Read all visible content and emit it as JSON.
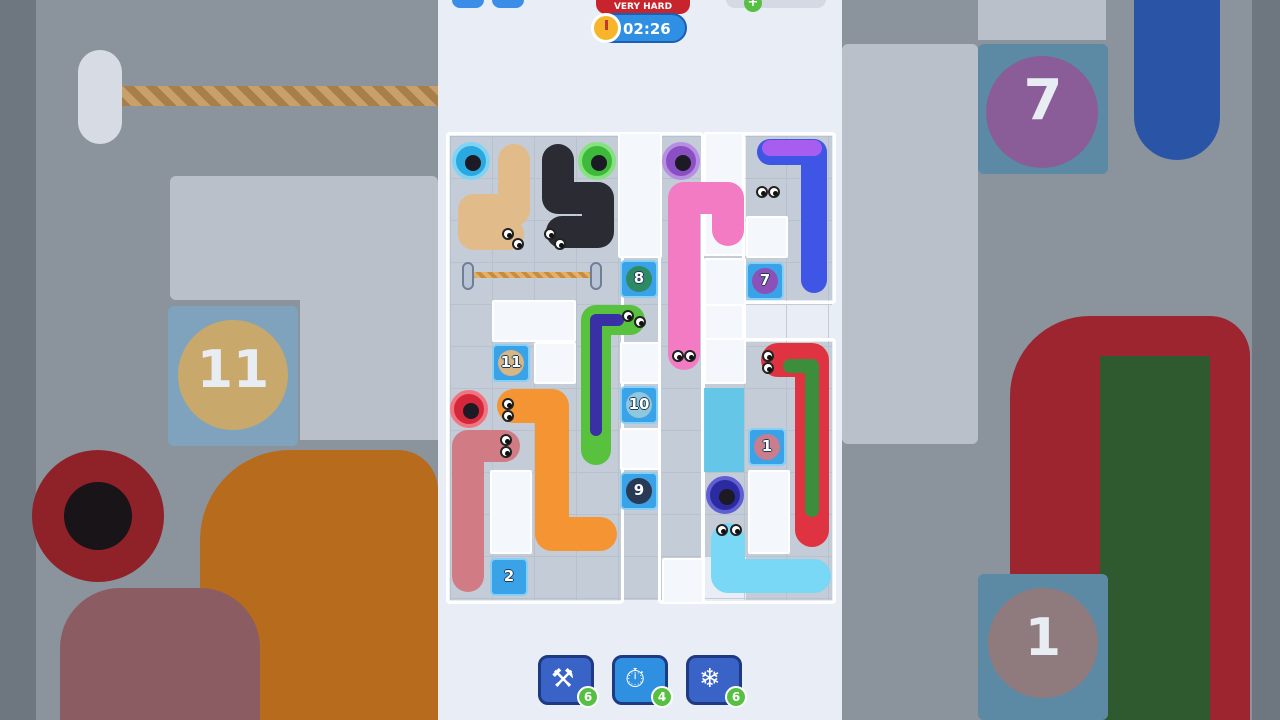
{
  "hud": {
    "difficulty": "VERY HARD",
    "timer": "02:26",
    "coin_plus": "+"
  },
  "tiles": {
    "t8": "8",
    "t7": "7",
    "t11": "11",
    "t10": "10",
    "t1": "1",
    "t9": "9",
    "t2": "2"
  },
  "boosters": [
    {
      "name": "hammer",
      "icon": "hammer-icon",
      "count": "6"
    },
    {
      "name": "freeze-time",
      "icon": "stopwatch-icon",
      "count": "4"
    },
    {
      "name": "snake-freeze",
      "icon": "snake-icon",
      "count": "6"
    }
  ],
  "background_tiles": {
    "t11": "11",
    "t7": "7",
    "t1": "1"
  },
  "colors": {
    "board": "#c9d1dc",
    "ice": "#5cc5ea",
    "timer": "#2e8fe3",
    "difficulty": "#c8242d"
  }
}
